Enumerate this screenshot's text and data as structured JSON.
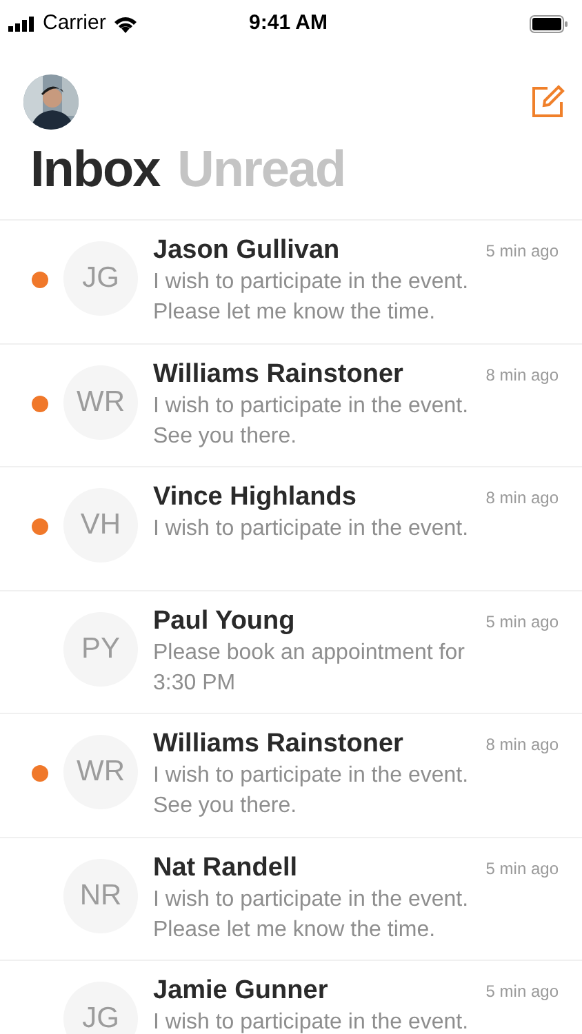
{
  "status_bar": {
    "carrier": "Carrier",
    "time": "9:41 AM"
  },
  "tabs": [
    {
      "label": "Inbox",
      "selected": true
    },
    {
      "label": "Unread",
      "selected": false
    }
  ],
  "messages": [
    {
      "initials": "JG",
      "name": "Jason Gullivan",
      "time": "5 min ago",
      "text": "I wish to participate in the event. Please let me know the time.",
      "unread": true
    },
    {
      "initials": "WR",
      "name": "Williams Rainstoner",
      "time": "8 min ago",
      "text": "I wish to participate in the event. See you there.",
      "unread": true
    },
    {
      "initials": "VH",
      "name": "Vince Highlands",
      "time": "8 min ago",
      "text": "I wish to participate in the event.",
      "unread": true
    },
    {
      "initials": "PY",
      "name": "Paul Young",
      "time": "5 min ago",
      "text": "Please book an appointment for 3:30 PM",
      "unread": false
    },
    {
      "initials": "WR",
      "name": "Williams Rainstoner",
      "time": "8 min ago",
      "text": "I wish to participate in the event. See you there.",
      "unread": true
    },
    {
      "initials": "NR",
      "name": "Nat Randell",
      "time": "5 min ago",
      "text": "I wish to participate in the event. Please let me know the time.",
      "unread": false
    },
    {
      "initials": "JG",
      "name": "Jamie Gunner",
      "time": "5 min ago",
      "text": "I wish to participate in the event.",
      "unread": false
    }
  ]
}
